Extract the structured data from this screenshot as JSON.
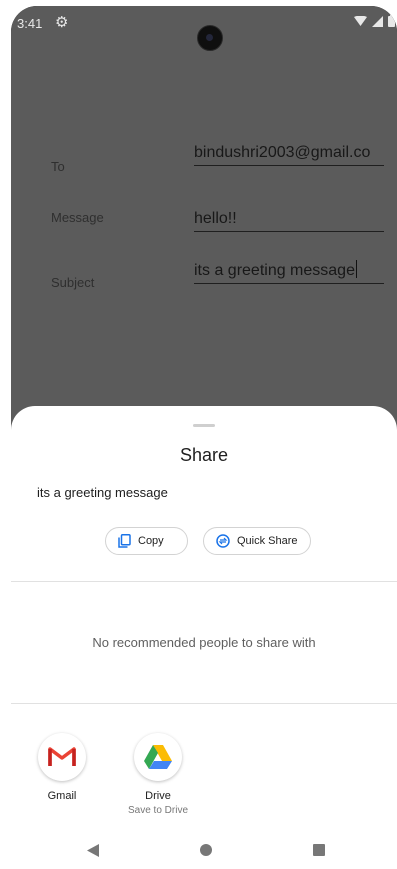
{
  "status_bar": {
    "time": "3:41",
    "settings_icon": "gear-icon",
    "right_icons": [
      "wifi-icon",
      "cell-signal-icon",
      "battery-icon"
    ]
  },
  "form": {
    "to_label": "To",
    "to_value": "bindushri2003@gmail.co",
    "message_label": "Message",
    "message_value": "hello!!",
    "subject_label": "Subject",
    "subject_value": "its a greeting message"
  },
  "share_sheet": {
    "title": "Share",
    "shared_text": "its a greeting message",
    "copy_label": "Copy",
    "quick_share_label": "Quick Share",
    "no_people_text": "No recommended people to share with",
    "apps": [
      {
        "name": "Gmail",
        "subtitle": ""
      },
      {
        "name": "Drive",
        "subtitle": "Save to Drive"
      }
    ]
  },
  "colors": {
    "dim_background": "#5b5b5b",
    "sheet_background": "#ffffff",
    "accent_blue": "#1a73e8",
    "gmail_red": "#ea4335"
  }
}
